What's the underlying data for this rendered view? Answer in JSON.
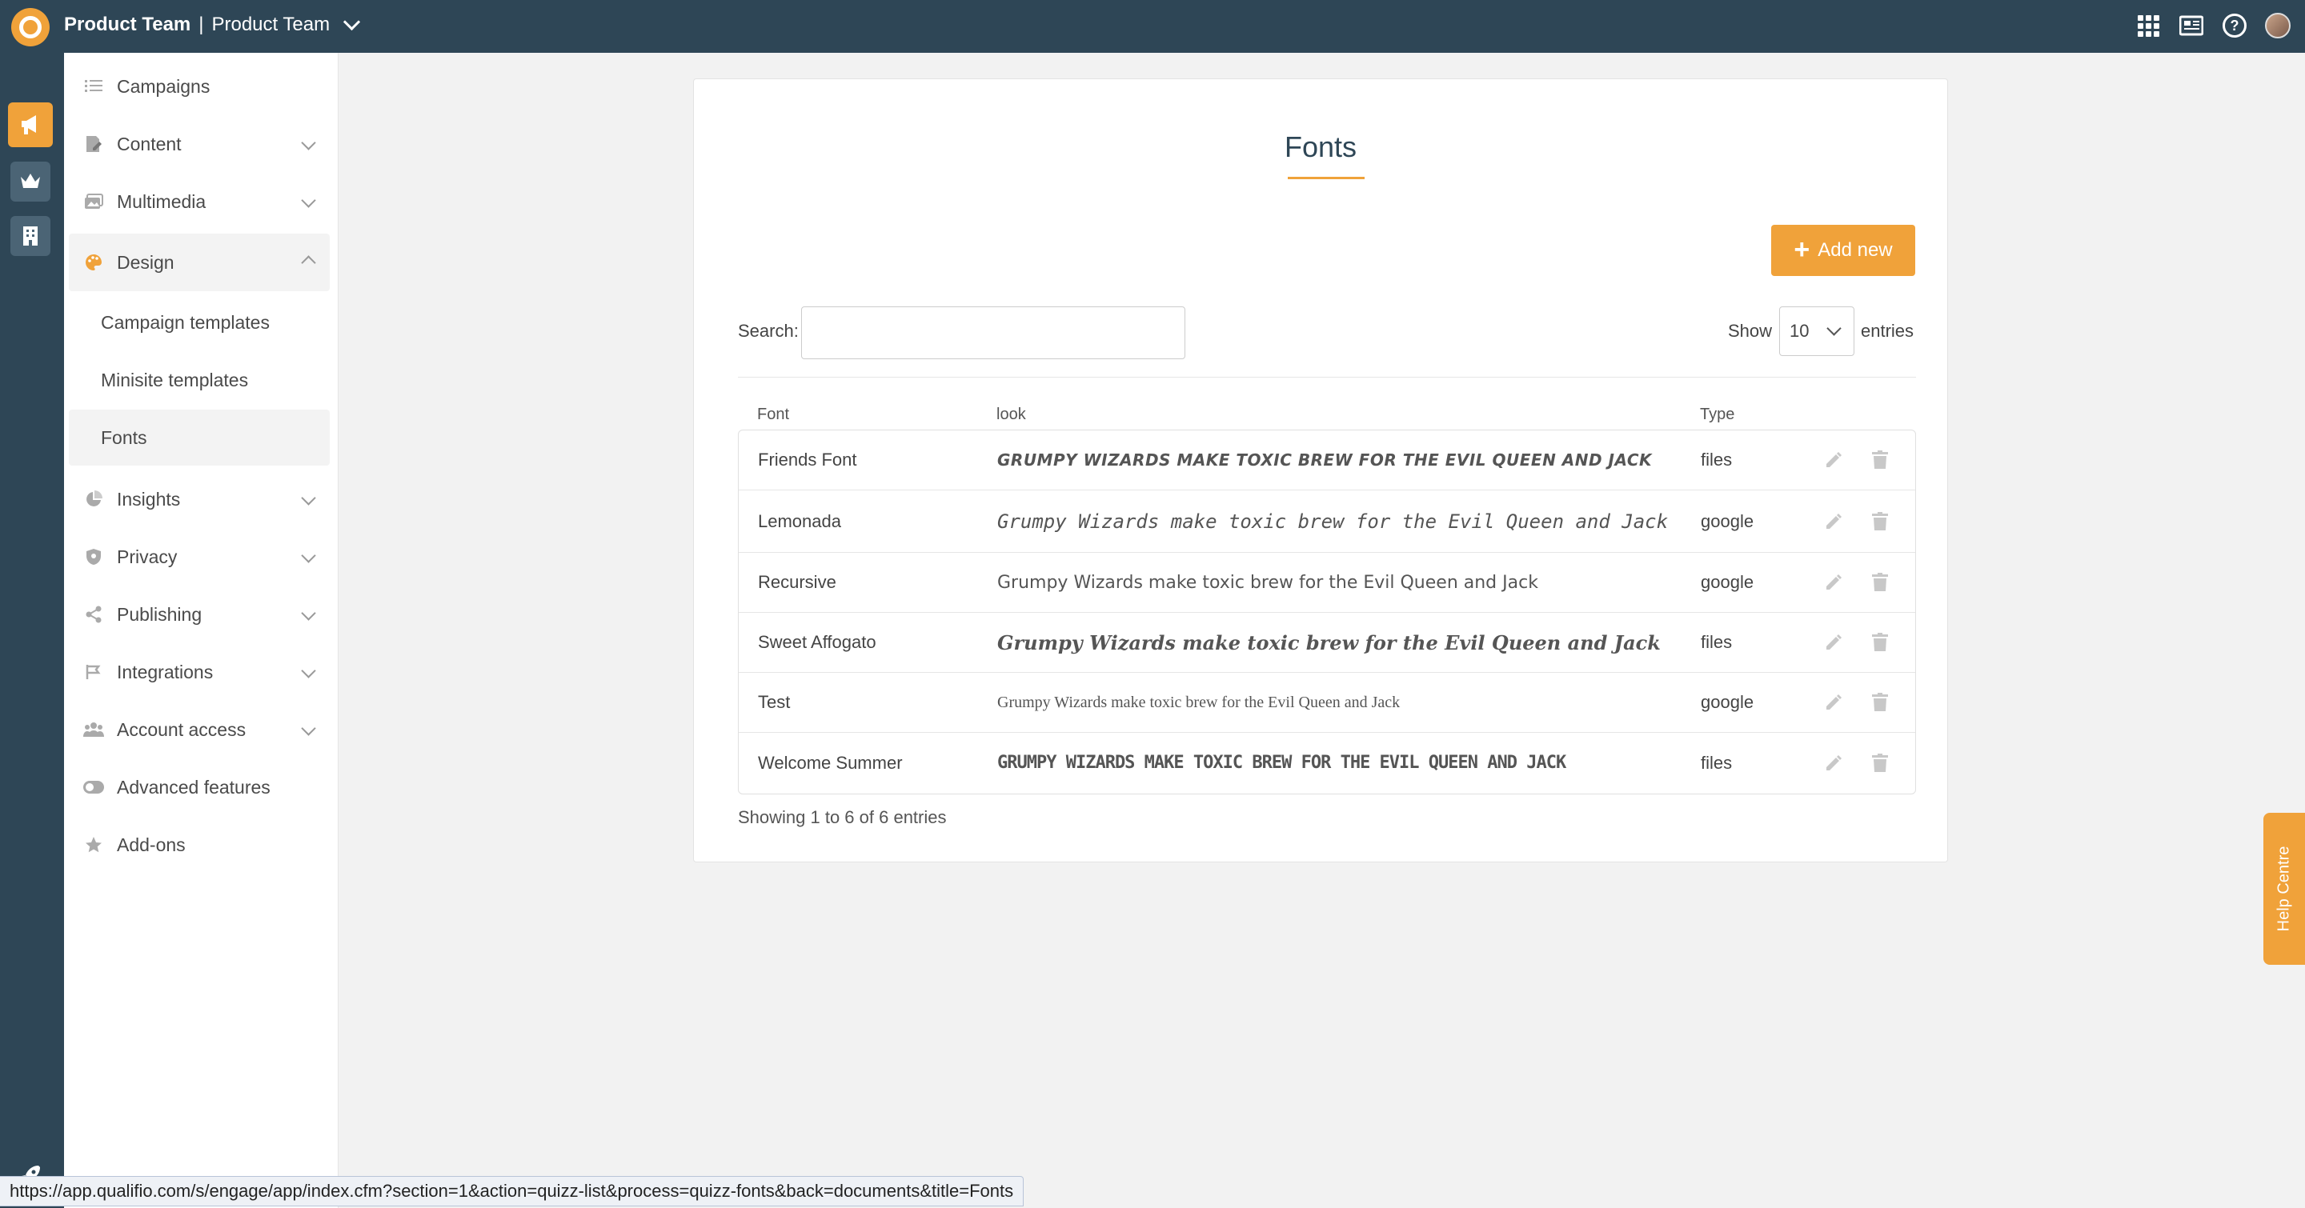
{
  "topbar": {
    "org_name": "Product Team",
    "separator": "|",
    "workspace_name": "Product Team"
  },
  "sidebar": {
    "items": [
      {
        "label": "Campaigns",
        "icon": "list-icon"
      },
      {
        "label": "Content",
        "icon": "content-icon"
      },
      {
        "label": "Multimedia",
        "icon": "images-icon"
      },
      {
        "label": "Design",
        "icon": "palette-icon"
      },
      {
        "label": "Insights",
        "icon": "pie-chart-icon"
      },
      {
        "label": "Privacy",
        "icon": "shield-icon"
      },
      {
        "label": "Publishing",
        "icon": "share-icon"
      },
      {
        "label": "Integrations",
        "icon": "integrations-icon"
      },
      {
        "label": "Account access",
        "icon": "users-icon"
      },
      {
        "label": "Advanced features",
        "icon": "toggle-icon"
      },
      {
        "label": "Add-ons",
        "icon": "star-icon"
      }
    ],
    "design_subitems": [
      {
        "label": "Campaign templates"
      },
      {
        "label": "Minisite templates"
      },
      {
        "label": "Fonts"
      }
    ]
  },
  "page": {
    "title": "Fonts",
    "add_button": "Add new",
    "search_label": "Search:",
    "search_value": "",
    "show_label": "Show",
    "show_value": "10",
    "entries_label": "entries",
    "showing_text": "Showing 1 to 6 of 6 entries"
  },
  "table": {
    "headers": {
      "font": "Font",
      "look": "look",
      "type": "Type"
    },
    "rows": [
      {
        "font": "Friends Font",
        "look": "Grumpy Wizards make toxic brew for the Evil Queen and Jack",
        "type": "files"
      },
      {
        "font": "Lemonada",
        "look": "Grumpy Wizards make toxic brew for the Evil Queen and Jack",
        "type": "google"
      },
      {
        "font": "Recursive",
        "look": "Grumpy Wizards make toxic brew for the Evil Queen and Jack",
        "type": "google"
      },
      {
        "font": "Sweet Affogato",
        "look": "Grumpy Wizards make toxic brew for the Evil Queen and Jack",
        "type": "files"
      },
      {
        "font": "Test",
        "look": "Grumpy Wizards make toxic brew for the Evil Queen and Jack",
        "type": "google"
      },
      {
        "font": "Welcome Summer",
        "look": "Grumpy Wizards make toxic brew for the Evil Queen and Jack",
        "type": "files"
      }
    ]
  },
  "help_tab": "Help Centre",
  "status_url": "https://app.qualifio.com/s/engage/app/index.cfm?section=1&action=quizz-list&process=quizz-fonts&back=documents&title=Fonts",
  "colors": {
    "accent": "#f0a23a",
    "topbar": "#2e4656"
  }
}
